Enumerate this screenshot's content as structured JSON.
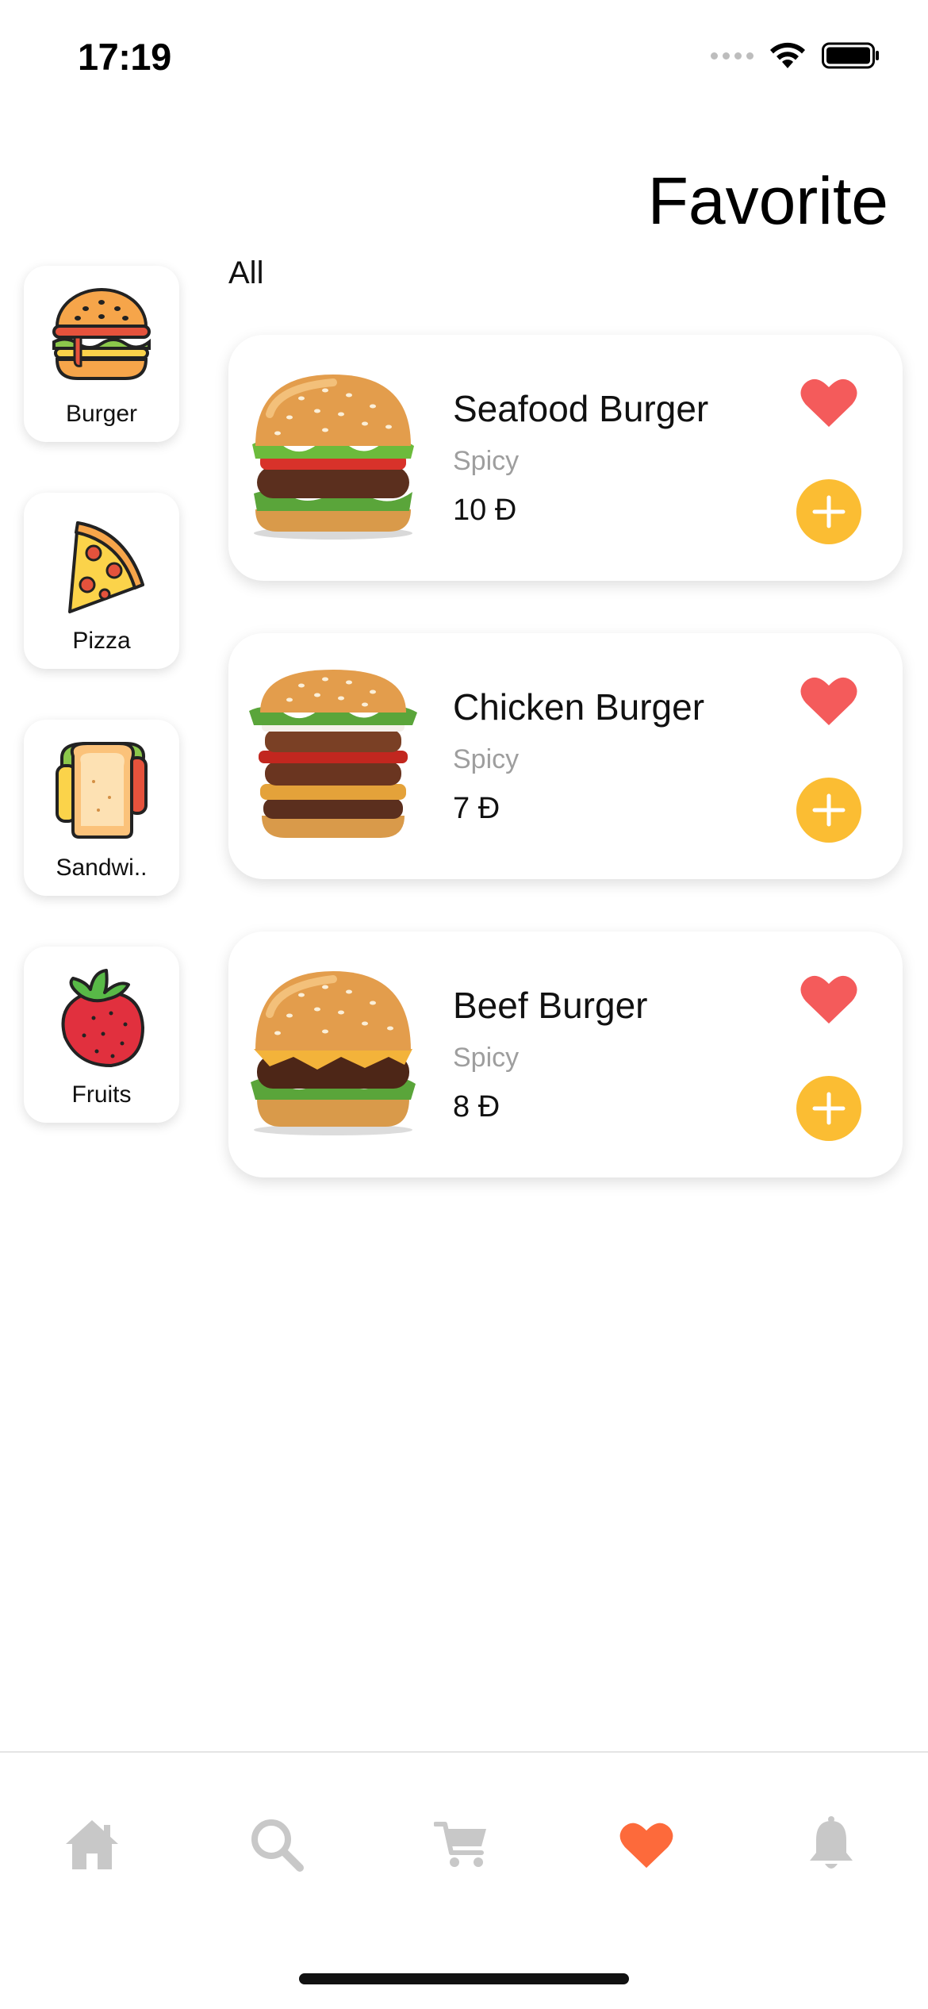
{
  "status_bar": {
    "time": "17:19"
  },
  "page_title": "Favorite",
  "filter_label": "All",
  "categories": [
    {
      "label": "Burger",
      "icon": "burger-icon"
    },
    {
      "label": "Pizza",
      "icon": "pizza-icon"
    },
    {
      "label": "Sandwi..",
      "icon": "sandwich-icon"
    },
    {
      "label": "Fruits",
      "icon": "strawberry-icon"
    }
  ],
  "favorites": [
    {
      "name": "Seafood Burger",
      "tag": "Spicy",
      "price": "10 Đ"
    },
    {
      "name": "Chicken Burger",
      "tag": "Spicy",
      "price": "7 Đ"
    },
    {
      "name": "Beef Burger",
      "tag": "Spicy",
      "price": "8 Đ"
    }
  ],
  "tab_bar": {
    "items": [
      {
        "icon": "home-icon",
        "active": false
      },
      {
        "icon": "search-icon",
        "active": false
      },
      {
        "icon": "cart-icon",
        "active": false
      },
      {
        "icon": "heart-icon",
        "active": true
      },
      {
        "icon": "bell-icon",
        "active": false
      }
    ]
  },
  "colors": {
    "accent_yellow": "#fbbd33",
    "heart_red": "#f45b5b",
    "active_tab": "#fd6a3b",
    "inactive_tab": "#c8c8c8",
    "muted_text": "#9e9e9e"
  }
}
